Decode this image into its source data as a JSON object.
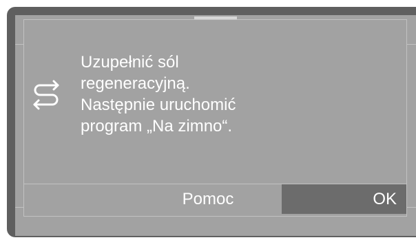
{
  "dialog": {
    "icon": "regeneration-arrows-icon",
    "message_lines": [
      "Uzupełnić sól",
      "regeneracyjną.",
      "Następnie uruchomić",
      "program „Na zimno“."
    ]
  },
  "buttons": {
    "help_label": "Pomoc",
    "ok_label": "OK"
  },
  "colors": {
    "screen_bg": "#a2a2a2",
    "bezel": "#5f5f5f",
    "selected_button": "#6c6c6c",
    "text": "#ffffff"
  }
}
